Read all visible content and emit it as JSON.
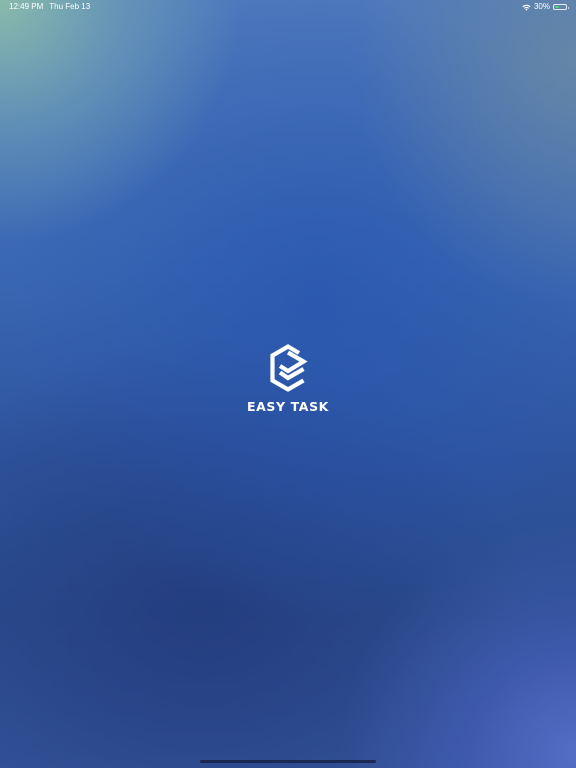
{
  "status_bar": {
    "time": "12:49 PM",
    "date": "Thu Feb 13",
    "battery_percent": "30%",
    "battery_level": 0.3,
    "battery_color": "#4cd964",
    "icons": [
      "wifi-icon",
      "battery-icon"
    ]
  },
  "splash": {
    "app_name": "EASY TASK",
    "logo_icon": "easy-task-hexagon-check-icon",
    "text_color": "#ffffff"
  },
  "colors": {
    "background_top_left": "#8cbeaa",
    "background_center": "#3a67b3",
    "background_bottom": "#2b4c8e",
    "background_bottom_right": "#5a72c8"
  }
}
